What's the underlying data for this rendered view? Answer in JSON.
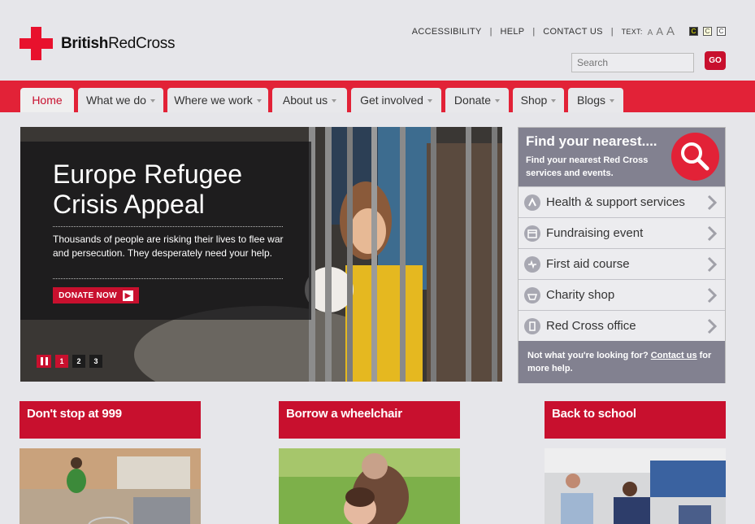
{
  "logo": {
    "text_bold": "British",
    "text_rest": "RedCross"
  },
  "toplinks": {
    "accessibility": "ACCESSIBILITY",
    "help": "HELP",
    "contact": "CONTACT US",
    "text_label": "TEXT:",
    "size_small": "A",
    "size_medium": "A",
    "size_large": "A",
    "contrast_1": "C",
    "contrast_2": "C",
    "contrast_3": "C",
    "separator": "|"
  },
  "search": {
    "placeholder": "Search",
    "go": "GO"
  },
  "nav": [
    "Home",
    "What we do",
    "Where we work",
    "About us",
    "Get involved",
    "Donate",
    "Shop",
    "Blogs"
  ],
  "hero": {
    "title": "Europe Refugee Crisis Appeal",
    "body": "Thousands of people are risking their lives to flee war and persecution. They desperately need your help.",
    "cta": "DONATE NOW",
    "slides": [
      "1",
      "2",
      "3"
    ]
  },
  "finder": {
    "title": "Find your nearest....",
    "subtitle": "Find your nearest Red Cross services and events.",
    "items": [
      "Health & support services",
      "Fundraising event",
      "First aid course",
      "Charity shop",
      "Red Cross office"
    ],
    "foot_text": "Not what you're looking for?",
    "foot_link": "Contact us",
    "foot_tail": "for more help."
  },
  "promos": [
    "Don't stop at 999",
    "Borrow a wheelchair",
    "Back to school"
  ],
  "colors": {
    "brand_red": "#e22237",
    "dark_red": "#c8102e",
    "panel_grey": "#828190",
    "page_bg": "#e6e6ea"
  }
}
